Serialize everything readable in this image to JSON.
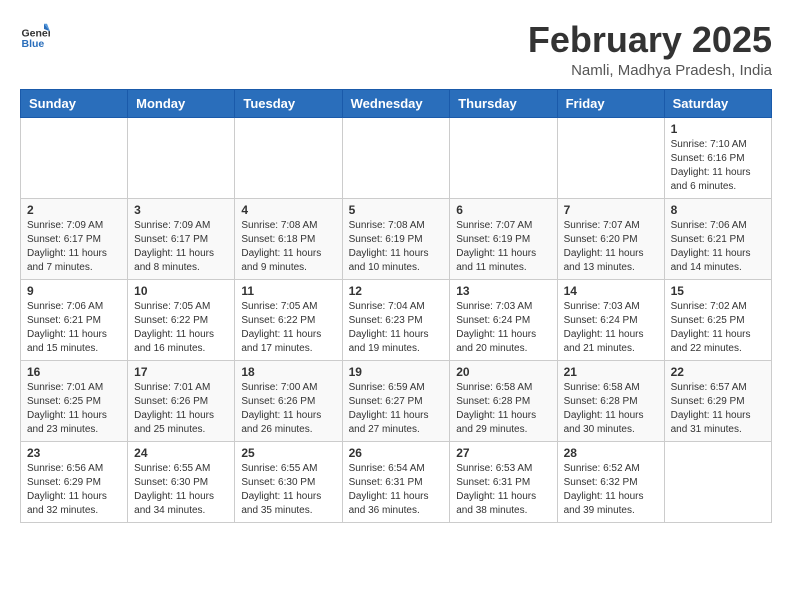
{
  "header": {
    "logo_general": "General",
    "logo_blue": "Blue",
    "main_title": "February 2025",
    "sub_title": "Namli, Madhya Pradesh, India"
  },
  "columns": [
    "Sunday",
    "Monday",
    "Tuesday",
    "Wednesday",
    "Thursday",
    "Friday",
    "Saturday"
  ],
  "weeks": [
    {
      "days": [
        {
          "num": "",
          "info": ""
        },
        {
          "num": "",
          "info": ""
        },
        {
          "num": "",
          "info": ""
        },
        {
          "num": "",
          "info": ""
        },
        {
          "num": "",
          "info": ""
        },
        {
          "num": "",
          "info": ""
        },
        {
          "num": "1",
          "info": "Sunrise: 7:10 AM\nSunset: 6:16 PM\nDaylight: 11 hours and 6 minutes."
        }
      ]
    },
    {
      "days": [
        {
          "num": "2",
          "info": "Sunrise: 7:09 AM\nSunset: 6:17 PM\nDaylight: 11 hours and 7 minutes."
        },
        {
          "num": "3",
          "info": "Sunrise: 7:09 AM\nSunset: 6:17 PM\nDaylight: 11 hours and 8 minutes."
        },
        {
          "num": "4",
          "info": "Sunrise: 7:08 AM\nSunset: 6:18 PM\nDaylight: 11 hours and 9 minutes."
        },
        {
          "num": "5",
          "info": "Sunrise: 7:08 AM\nSunset: 6:19 PM\nDaylight: 11 hours and 10 minutes."
        },
        {
          "num": "6",
          "info": "Sunrise: 7:07 AM\nSunset: 6:19 PM\nDaylight: 11 hours and 11 minutes."
        },
        {
          "num": "7",
          "info": "Sunrise: 7:07 AM\nSunset: 6:20 PM\nDaylight: 11 hours and 13 minutes."
        },
        {
          "num": "8",
          "info": "Sunrise: 7:06 AM\nSunset: 6:21 PM\nDaylight: 11 hours and 14 minutes."
        }
      ]
    },
    {
      "days": [
        {
          "num": "9",
          "info": "Sunrise: 7:06 AM\nSunset: 6:21 PM\nDaylight: 11 hours and 15 minutes."
        },
        {
          "num": "10",
          "info": "Sunrise: 7:05 AM\nSunset: 6:22 PM\nDaylight: 11 hours and 16 minutes."
        },
        {
          "num": "11",
          "info": "Sunrise: 7:05 AM\nSunset: 6:22 PM\nDaylight: 11 hours and 17 minutes."
        },
        {
          "num": "12",
          "info": "Sunrise: 7:04 AM\nSunset: 6:23 PM\nDaylight: 11 hours and 19 minutes."
        },
        {
          "num": "13",
          "info": "Sunrise: 7:03 AM\nSunset: 6:24 PM\nDaylight: 11 hours and 20 minutes."
        },
        {
          "num": "14",
          "info": "Sunrise: 7:03 AM\nSunset: 6:24 PM\nDaylight: 11 hours and 21 minutes."
        },
        {
          "num": "15",
          "info": "Sunrise: 7:02 AM\nSunset: 6:25 PM\nDaylight: 11 hours and 22 minutes."
        }
      ]
    },
    {
      "days": [
        {
          "num": "16",
          "info": "Sunrise: 7:01 AM\nSunset: 6:25 PM\nDaylight: 11 hours and 23 minutes."
        },
        {
          "num": "17",
          "info": "Sunrise: 7:01 AM\nSunset: 6:26 PM\nDaylight: 11 hours and 25 minutes."
        },
        {
          "num": "18",
          "info": "Sunrise: 7:00 AM\nSunset: 6:26 PM\nDaylight: 11 hours and 26 minutes."
        },
        {
          "num": "19",
          "info": "Sunrise: 6:59 AM\nSunset: 6:27 PM\nDaylight: 11 hours and 27 minutes."
        },
        {
          "num": "20",
          "info": "Sunrise: 6:58 AM\nSunset: 6:28 PM\nDaylight: 11 hours and 29 minutes."
        },
        {
          "num": "21",
          "info": "Sunrise: 6:58 AM\nSunset: 6:28 PM\nDaylight: 11 hours and 30 minutes."
        },
        {
          "num": "22",
          "info": "Sunrise: 6:57 AM\nSunset: 6:29 PM\nDaylight: 11 hours and 31 minutes."
        }
      ]
    },
    {
      "days": [
        {
          "num": "23",
          "info": "Sunrise: 6:56 AM\nSunset: 6:29 PM\nDaylight: 11 hours and 32 minutes."
        },
        {
          "num": "24",
          "info": "Sunrise: 6:55 AM\nSunset: 6:30 PM\nDaylight: 11 hours and 34 minutes."
        },
        {
          "num": "25",
          "info": "Sunrise: 6:55 AM\nSunset: 6:30 PM\nDaylight: 11 hours and 35 minutes."
        },
        {
          "num": "26",
          "info": "Sunrise: 6:54 AM\nSunset: 6:31 PM\nDaylight: 11 hours and 36 minutes."
        },
        {
          "num": "27",
          "info": "Sunrise: 6:53 AM\nSunset: 6:31 PM\nDaylight: 11 hours and 38 minutes."
        },
        {
          "num": "28",
          "info": "Sunrise: 6:52 AM\nSunset: 6:32 PM\nDaylight: 11 hours and 39 minutes."
        },
        {
          "num": "",
          "info": ""
        }
      ]
    }
  ]
}
